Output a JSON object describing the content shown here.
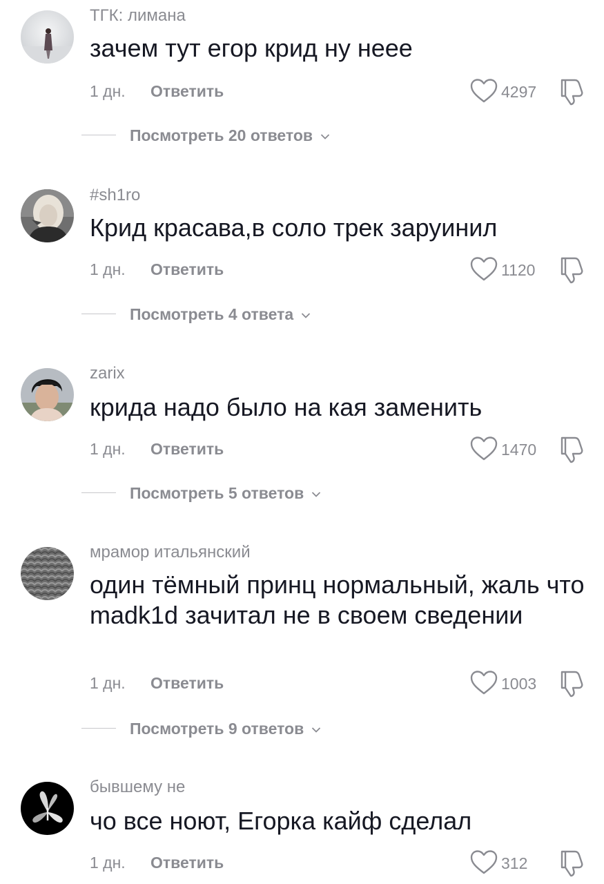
{
  "comments": [
    {
      "username": "ТГК: лимана",
      "text": "зачем тут егор крид ну неее",
      "time": "1 дн.",
      "reply_label": "Ответить",
      "likes": "4297",
      "view_replies": "Посмотреть 20 ответов",
      "avatar_icon": "avatar-girl-in-fog"
    },
    {
      "username": "#sh1ro",
      "text": "Крид красава,в соло трек заруинил",
      "time": "1 дн.",
      "reply_label": "Ответить",
      "likes": "1120",
      "view_replies": "Посмотреть 4 ответа",
      "avatar_icon": "avatar-blonde-portrait"
    },
    {
      "username": "zarix",
      "text": "крида надо было на кая заменить",
      "time": "1 дн.",
      "reply_label": "Ответить",
      "likes": "1470",
      "view_replies": "Посмотреть 5 ответов",
      "avatar_icon": "avatar-face-portrait"
    },
    {
      "username": "мрамор итальянский",
      "text": "один тёмный принц нормальный, жаль что madk1d зачитал не в своем сведении",
      "time": "1 дн.",
      "reply_label": "Ответить",
      "likes": "1003",
      "view_replies": "Посмотреть 9 ответов",
      "avatar_icon": "avatar-gray-texture"
    },
    {
      "username": "бывшему не",
      "text": "чо все ноют, Егорка кайф сделал",
      "time": "1 дн.",
      "reply_label": "Ответить",
      "likes": "312",
      "avatar_icon": "avatar-moth"
    }
  ],
  "colors": {
    "text": "#161823",
    "secondary": "#8a8b91",
    "divider": "#c7c7cb",
    "background": "#ffffff"
  }
}
